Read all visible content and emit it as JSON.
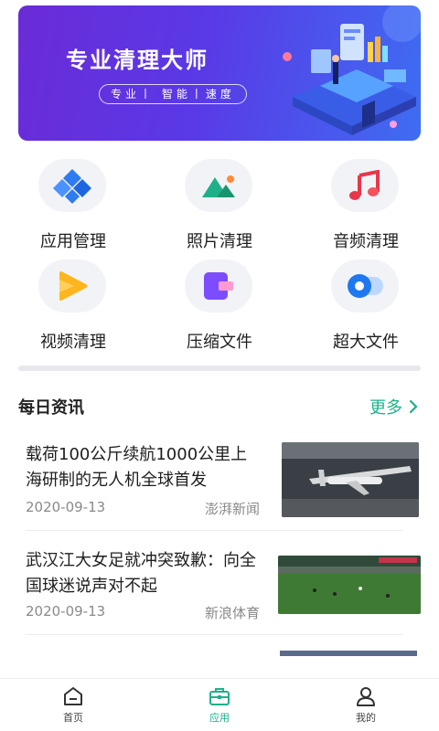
{
  "banner": {
    "title": "专业清理大师",
    "subtitle": "专业丨 智能丨速度"
  },
  "features": [
    {
      "label": "应用管理",
      "icon": "app-management-icon"
    },
    {
      "label": "照片清理",
      "icon": "photo-clean-icon"
    },
    {
      "label": "音频清理",
      "icon": "audio-clean-icon"
    },
    {
      "label": "视频清理",
      "icon": "video-clean-icon"
    },
    {
      "label": "压缩文件",
      "icon": "compressed-file-icon"
    },
    {
      "label": "超大文件",
      "icon": "large-file-icon"
    }
  ],
  "news": {
    "title": "每日资讯",
    "more_label": "更多",
    "items": [
      {
        "headline": "载荷100公斤续航1000公里上海研制的无人机全球首发",
        "date": "2020-09-13",
        "source": "澎湃新闻"
      },
      {
        "headline": "武汉江大女足就冲突致歉：向全国球迷说声对不起",
        "date": "2020-09-13",
        "source": "新浪体育"
      }
    ]
  },
  "tabs": [
    {
      "label": "首页",
      "icon": "home-icon"
    },
    {
      "label": "应用",
      "icon": "briefcase-icon",
      "active": true
    },
    {
      "label": "我的",
      "icon": "profile-icon"
    }
  ],
  "colors": {
    "accent": "#1fb08a",
    "banner_start": "#6a2bd6",
    "banner_end": "#3e6df2"
  }
}
